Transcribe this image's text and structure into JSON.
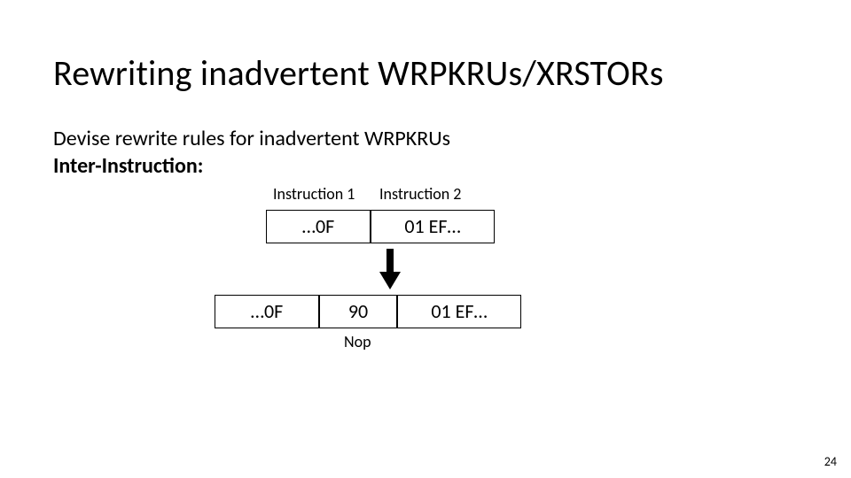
{
  "title": "Rewriting inadvertent WRPKRUs/XRSTORs",
  "body_line1": "Devise rewrite rules for inadvertent WRPKRUs",
  "body_line2_label": "Inter-Instruction:",
  "diagram": {
    "instr1_label": "Instruction 1",
    "instr2_label": "Instruction 2",
    "row1_cell1": "…0F",
    "row1_cell2": "01 EF…",
    "row2_cell1": "…0F",
    "row2_cell2": "90",
    "row2_cell3": "01 EF…",
    "nop_label": "Nop"
  },
  "page_number": "24"
}
